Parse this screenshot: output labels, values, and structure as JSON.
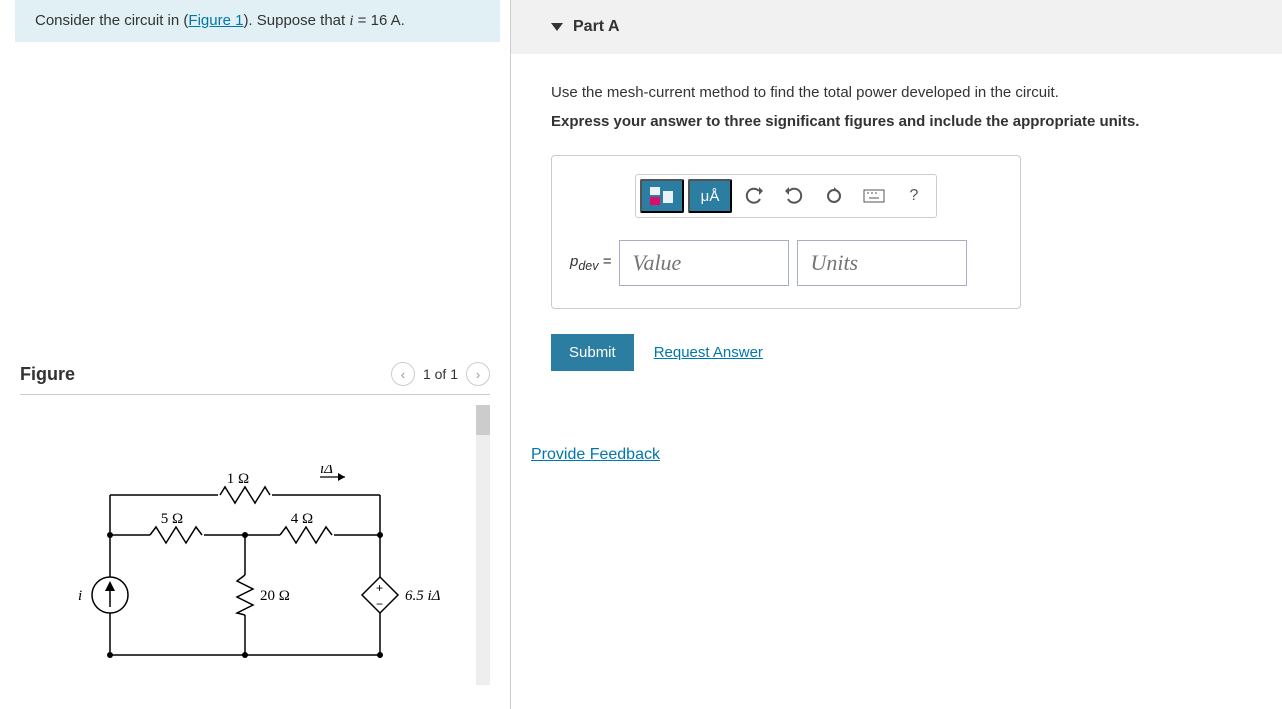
{
  "problem": {
    "prefix": "Consider the circuit in (",
    "figure_link": "Figure 1",
    "suffix": "). Suppose that ",
    "variable": "i",
    "equals": " = 16 A."
  },
  "figure": {
    "title": "Figure",
    "nav_count": "1 of 1",
    "circuit": {
      "r_top": "1 Ω",
      "r_left": "5 Ω",
      "r_right": "4 Ω",
      "r_mid": "20 Ω",
      "i_label": "i",
      "i_delta": "iΔ",
      "dep_src": "6.5 iΔ"
    }
  },
  "part": {
    "title": "Part A",
    "question": "Use the mesh-current method to find the total power developed in the circuit.",
    "instruction": "Express your answer to three significant figures and include the appropriate units.",
    "answer_label": "pdev = ",
    "value_placeholder": "Value",
    "units_placeholder": "Units",
    "toolbar": {
      "mua": "μÅ",
      "help": "?"
    },
    "submit": "Submit",
    "request": "Request Answer"
  },
  "feedback": "Provide Feedback"
}
